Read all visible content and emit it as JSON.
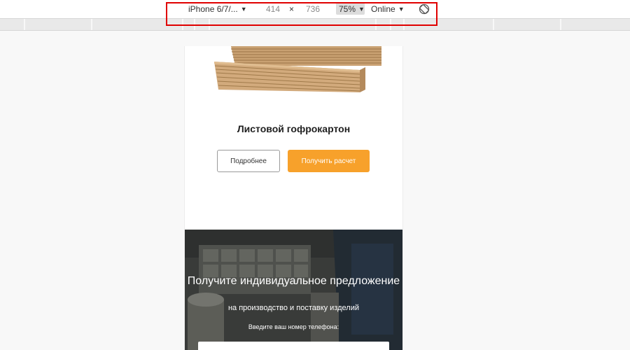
{
  "devtools": {
    "device": "iPhone 6/7/...",
    "width": "414",
    "separator": "×",
    "height": "736",
    "zoom": "75%",
    "throttle": "Online",
    "caret": "▼",
    "rotate_icon": "rotate-icon",
    "highlight_color": "#e00000"
  },
  "page": {
    "product": {
      "title": "Листовой гофрокартон",
      "more_button": "Подробнее",
      "calc_button": "Получить расчет",
      "accent_color": "#f7a12b"
    },
    "promo": {
      "title": "Получите индивидуальное предложение",
      "subtitle": "на производство и поставку изделий",
      "phone_label": "Введите ваш номер телефона:",
      "phone_value": ""
    }
  }
}
